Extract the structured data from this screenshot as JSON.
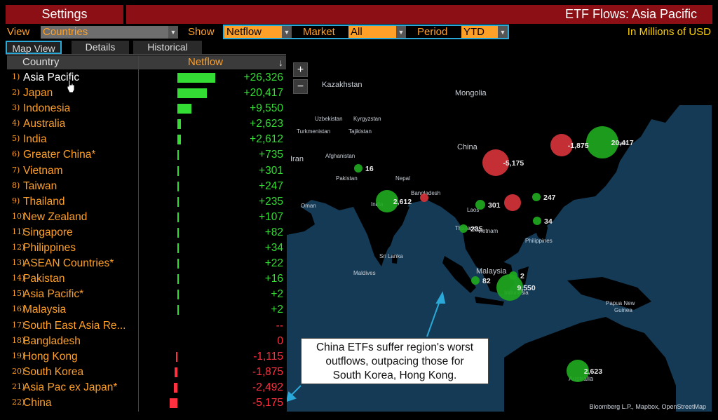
{
  "header": {
    "settings_label": "Settings",
    "title": "ETF Flows: Asia Pacific"
  },
  "controls": {
    "view_label": "View",
    "view_value": "Countries",
    "show_label": "Show",
    "show_value": "Netflow",
    "market_label": "Market",
    "market_value": "All",
    "period_label": "Period",
    "period_value": "YTD",
    "units": "In Millions of USD"
  },
  "tabs": [
    "Map View",
    "Details",
    "Historical"
  ],
  "table": {
    "col_country": "Country",
    "col_netflow": "Netflow",
    "sort_icon": "↓",
    "rows": [
      {
        "rank": "1)",
        "name": "Asia Pacific",
        "value": "+26,326",
        "num": 26326
      },
      {
        "rank": "2)",
        "name": "Japan",
        "value": "+20,417",
        "num": 20417
      },
      {
        "rank": "3)",
        "name": "Indonesia",
        "value": "+9,550",
        "num": 9550
      },
      {
        "rank": "4)",
        "name": "Australia",
        "value": "+2,623",
        "num": 2623
      },
      {
        "rank": "5)",
        "name": "India",
        "value": "+2,612",
        "num": 2612
      },
      {
        "rank": "6)",
        "name": "Greater China*",
        "value": "+735",
        "num": 735
      },
      {
        "rank": "7)",
        "name": "Vietnam",
        "value": "+301",
        "num": 301
      },
      {
        "rank": "8)",
        "name": "Taiwan",
        "value": "+247",
        "num": 247
      },
      {
        "rank": "9)",
        "name": "Thailand",
        "value": "+235",
        "num": 235
      },
      {
        "rank": "10)",
        "name": "New Zealand",
        "value": "+107",
        "num": 107
      },
      {
        "rank": "11)",
        "name": "Singapore",
        "value": "+82",
        "num": 82
      },
      {
        "rank": "12)",
        "name": "Philippines",
        "value": "+34",
        "num": 34
      },
      {
        "rank": "13)",
        "name": "ASEAN Countries*",
        "value": "+22",
        "num": 22
      },
      {
        "rank": "14)",
        "name": "Pakistan",
        "value": "+16",
        "num": 16
      },
      {
        "rank": "15)",
        "name": "Asia Pacific*",
        "value": "+2",
        "num": 2
      },
      {
        "rank": "16)",
        "name": "Malaysia",
        "value": "+2",
        "num": 2
      },
      {
        "rank": "17)",
        "name": "South East Asia Re...",
        "value": "--",
        "num": null
      },
      {
        "rank": "18)",
        "name": "Bangladesh",
        "value": "0",
        "num": 0
      },
      {
        "rank": "19)",
        "name": "Hong Kong",
        "value": "-1,115",
        "num": -1115
      },
      {
        "rank": "20)",
        "name": "South Korea",
        "value": "-1,875",
        "num": -1875
      },
      {
        "rank": "21)",
        "name": "Asia Pac ex Japan*",
        "value": "-2,492",
        "num": -2492
      },
      {
        "rank": "22)",
        "name": "China",
        "value": "-5,175",
        "num": -5175
      }
    ]
  },
  "map": {
    "zoom_in": "+",
    "zoom_out": "−",
    "attribution": "Bloomberg L.P., Mapbox, OpenStreetMap",
    "place_labels": [
      "Kazakhstan",
      "Mongolia",
      "Uzbekistan",
      "Kyrgyzstan",
      "Turkmenistan",
      "Tajikistan",
      "China",
      "Iran",
      "Afghanistan",
      "Pakistan",
      "Nepal",
      "Bangladesh",
      "Oman",
      "Laos",
      "Vietnam",
      "Philippines",
      "Sri Lanka",
      "Maldives",
      "Malaysia",
      "Papua New Guinea",
      "Japan",
      "India",
      "Thailand",
      "Indonesia",
      "Australia"
    ],
    "bubbles": [
      {
        "label": "20,417",
        "sign": "pos"
      },
      {
        "label": "-1,875",
        "sign": "neg"
      },
      {
        "label": "-5,175",
        "sign": "neg"
      },
      {
        "label": "16",
        "sign": "pos"
      },
      {
        "label": "2,612",
        "sign": "pos"
      },
      {
        "label": "",
        "sign": "neg"
      },
      {
        "label": "301",
        "sign": "pos"
      },
      {
        "label": "",
        "sign": "neg"
      },
      {
        "label": "247",
        "sign": "pos"
      },
      {
        "label": "34",
        "sign": "pos"
      },
      {
        "label": "235",
        "sign": "pos"
      },
      {
        "label": "82",
        "sign": "pos"
      },
      {
        "label": "2",
        "sign": "pos"
      },
      {
        "label": "9,550",
        "sign": "pos"
      },
      {
        "label": "2,623",
        "sign": "pos"
      }
    ]
  },
  "callout": {
    "lines": [
      "China ETFs suffer region's worst",
      "outflows, outpacing those for",
      "South Korea, Hong Kong."
    ]
  },
  "colors": {
    "positive": "#33dd33",
    "negative": "#ff3040",
    "accent": "#ffa028",
    "title_bar": "#8b0f14",
    "highlight": "#2aa8d8"
  }
}
